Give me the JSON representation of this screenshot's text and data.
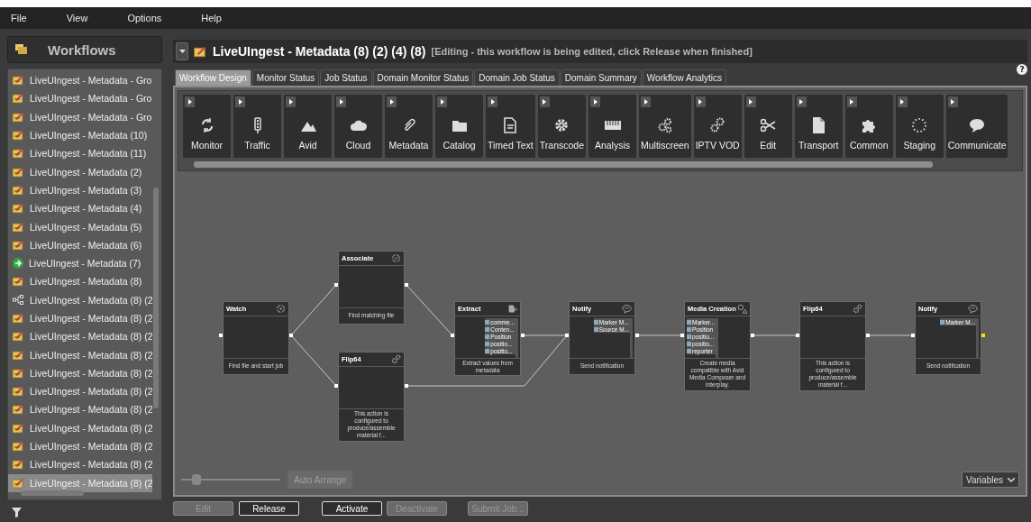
{
  "menu": [
    "File",
    "View",
    "Options",
    "Help"
  ],
  "sidebar": {
    "title": "Workflows",
    "items": [
      {
        "label": "LiveUIngest - Metadata - Gro",
        "kind": "edit",
        "selected": false
      },
      {
        "label": "LiveUIngest - Metadata - Gro",
        "kind": "edit",
        "selected": false
      },
      {
        "label": "LiveUIngest - Metadata - Gro",
        "kind": "edit",
        "selected": false
      },
      {
        "label": "LiveUIngest - Metadata (10)",
        "kind": "edit",
        "selected": false
      },
      {
        "label": "LiveUIngest - Metadata (11)",
        "kind": "edit",
        "selected": false
      },
      {
        "label": "LiveUIngest - Metadata (2)",
        "kind": "edit",
        "selected": false
      },
      {
        "label": "LiveUIngest - Metadata (3)",
        "kind": "edit",
        "selected": false
      },
      {
        "label": "LiveUIngest - Metadata (4)",
        "kind": "edit",
        "selected": false
      },
      {
        "label": "LiveUIngest - Metadata (5)",
        "kind": "edit",
        "selected": false
      },
      {
        "label": "LiveUIngest - Metadata (6)",
        "kind": "edit",
        "selected": false
      },
      {
        "label": "LiveUIngest - Metadata (7)",
        "kind": "active",
        "selected": false
      },
      {
        "label": "LiveUIngest - Metadata (8)",
        "kind": "edit",
        "selected": false
      },
      {
        "label": "LiveUIngest - Metadata (8) (2",
        "kind": "template",
        "selected": false
      },
      {
        "label": "LiveUIngest - Metadata (8) (2",
        "kind": "edit",
        "selected": false
      },
      {
        "label": "LiveUIngest - Metadata (8) (2",
        "kind": "edit",
        "selected": false
      },
      {
        "label": "LiveUIngest - Metadata (8) (2",
        "kind": "edit",
        "selected": false
      },
      {
        "label": "LiveUIngest - Metadata (8) (2",
        "kind": "edit",
        "selected": false
      },
      {
        "label": "LiveUIngest - Metadata (8) (2",
        "kind": "edit",
        "selected": false
      },
      {
        "label": "LiveUIngest - Metadata (8) (2",
        "kind": "edit",
        "selected": false
      },
      {
        "label": "LiveUIngest - Metadata (8) (2",
        "kind": "edit",
        "selected": false
      },
      {
        "label": "LiveUIngest - Metadata (8) (2",
        "kind": "edit",
        "selected": false
      },
      {
        "label": "LiveUIngest - Metadata (8) (2",
        "kind": "edit",
        "selected": false
      },
      {
        "label": "LiveUIngest - Metadata (8) (2",
        "kind": "edit",
        "selected": true
      }
    ]
  },
  "workflow": {
    "title": "LiveUIngest - Metadata (8) (2) (4) (8)",
    "status": "[Editing - this workflow is being edited, click Release when finished]"
  },
  "help": "?",
  "tabs": [
    {
      "label": "Workflow Design",
      "selected": true
    },
    {
      "label": "Monitor Status",
      "selected": false
    },
    {
      "label": "Job Status",
      "selected": false
    },
    {
      "label": "Domain Monitor Status",
      "selected": false
    },
    {
      "label": "Domain Job Status",
      "selected": false
    },
    {
      "label": "Domain Summary",
      "selected": false
    },
    {
      "label": "Workflow Analytics",
      "selected": false
    }
  ],
  "palette": [
    "Monitor",
    "Traffic",
    "Avid",
    "Cloud",
    "Metadata",
    "Catalog",
    "Timed Text",
    "Transcode",
    "Analysis",
    "Multiscreen",
    "IPTV VOD",
    "Edit",
    "Transport",
    "Common",
    "Staging",
    "Communicate"
  ],
  "nodes": [
    {
      "title": "Watch",
      "kind": "watch",
      "description": "Find file and start job"
    },
    {
      "title": "Associate",
      "kind": "associate",
      "description": "Find matching file"
    },
    {
      "title": "Flip64",
      "kind": "flip",
      "description": "This action is configured to produce/assemble material f..."
    },
    {
      "title": "Extract",
      "kind": "extract",
      "description": "Extract values from metadata",
      "params": [
        "comme...",
        "Conten...",
        "Position",
        "positio...",
        "positio..."
      ]
    },
    {
      "title": "Notify",
      "kind": "notify",
      "description": "Send notification",
      "params": [
        "Marker M...",
        "Source M..."
      ]
    },
    {
      "title": "Media Creation",
      "kind": "media",
      "description": "Create media compatible with Avid Media Composer and Interplay.",
      "params": [
        "Marker...",
        "Position",
        "positio...",
        "positio...",
        "reporter"
      ]
    },
    {
      "title": "Flip64",
      "kind": "flip",
      "description": "This action is configured to produce/assemble material f..."
    },
    {
      "title": "Notify",
      "kind": "notify",
      "description": "Send notification",
      "params": [
        "Marker M..."
      ]
    }
  ],
  "zoom": {
    "level": 0.15
  },
  "auto_arrange": {
    "label": "Auto Arrange",
    "disabled": true
  },
  "variables": "Variables",
  "buttons": [
    {
      "label": "Edit",
      "disabled": true
    },
    {
      "label": "Release",
      "disabled": false
    },
    {
      "label": "Activate",
      "disabled": false
    },
    {
      "label": "Deactivate",
      "disabled": true
    },
    {
      "label": "Submit Job...",
      "disabled": true
    }
  ]
}
